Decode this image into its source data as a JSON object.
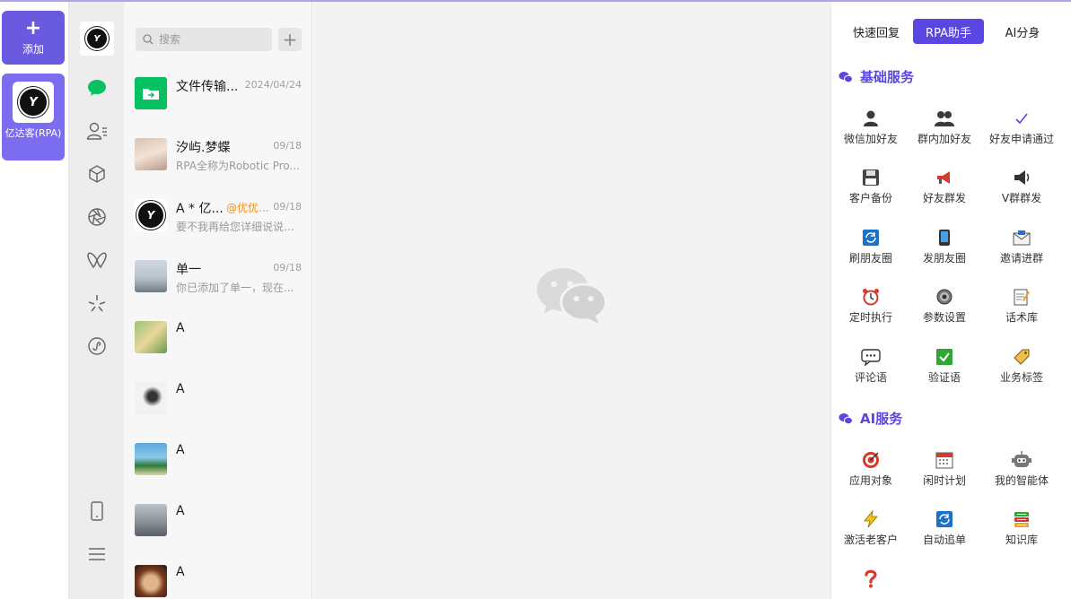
{
  "accounts": {
    "add_label": "添加",
    "items": [
      {
        "name": "亿达客(RPA)",
        "logo_text": "Y"
      }
    ]
  },
  "rail": {
    "icons": [
      "chat-icon",
      "contacts-icon",
      "cube-icon",
      "aperture-icon",
      "butterfly-icon",
      "sparkle-icon",
      "mini-program-icon",
      "phone-icon",
      "menu-icon"
    ],
    "accent": "#07c160"
  },
  "search": {
    "placeholder": "搜索"
  },
  "chats": [
    {
      "name": "文件传输...",
      "time": "2024/04/24",
      "msg": ""
    },
    {
      "name": "汐屿.梦蝶",
      "time": "09/18",
      "msg": "RPA全称为Robotic Pro..."
    },
    {
      "name": "A * 亿...",
      "mention": "@优优...",
      "time": "09/18",
      "msg": "要不我再给您详细说说..."
    },
    {
      "name": "单一",
      "time": "09/18",
      "msg": "你已添加了单一，现在..."
    },
    {
      "name": "A",
      "time": "",
      "msg": ""
    },
    {
      "name": "A",
      "time": "",
      "msg": ""
    },
    {
      "name": "A",
      "time": "",
      "msg": ""
    },
    {
      "name": "A",
      "time": "",
      "msg": ""
    },
    {
      "name": "A",
      "time": "",
      "msg": ""
    }
  ],
  "right": {
    "tabs": [
      "快速回复",
      "RPA助手",
      "AI分身"
    ],
    "active_tab": 1,
    "sections": [
      {
        "title": "基础服务",
        "tools": [
          "微信加好友",
          "群内加好友",
          "好友申请通过",
          "客户备份",
          "好友群发",
          "V群群发",
          "刷朋友圈",
          "发朋友圈",
          "邀请进群",
          "定时执行",
          "参数设置",
          "话术库",
          "评论语",
          "验证语",
          "业务标签"
        ]
      },
      {
        "title": "AI服务",
        "tools": [
          "应用对象",
          "闲时计划",
          "我的智能体",
          "激活老客户",
          "自动追单",
          "知识库",
          ""
        ]
      }
    ],
    "accent": "#5a46e0"
  }
}
